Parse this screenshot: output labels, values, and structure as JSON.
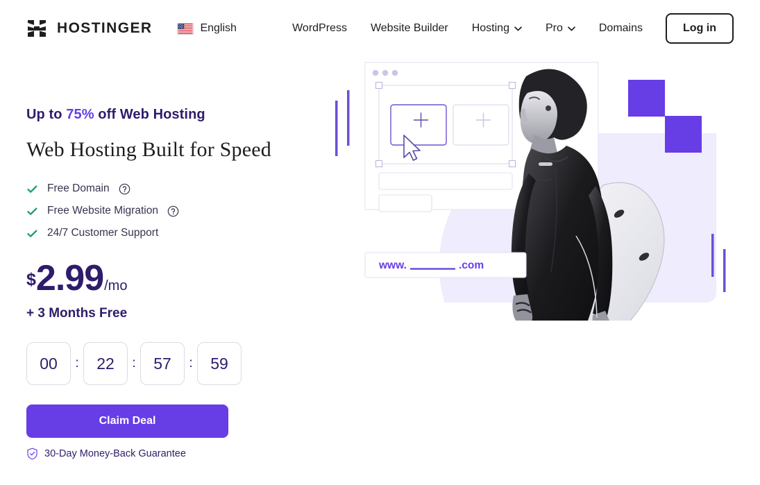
{
  "header": {
    "logo_icon": "hostinger-h-logo-icon",
    "brand_name": "HOSTINGER",
    "language": {
      "flag_icon": "us-flag-icon",
      "label": "English"
    },
    "nav_items": [
      {
        "label": "WordPress",
        "has_dropdown": false
      },
      {
        "label": "Website Builder",
        "has_dropdown": false
      },
      {
        "label": "Hosting",
        "has_dropdown": true
      },
      {
        "label": "Pro",
        "has_dropdown": true
      },
      {
        "label": "Domains",
        "has_dropdown": false
      }
    ],
    "login_label": "Log in"
  },
  "hero": {
    "eyebrow_prefix": "Up to ",
    "eyebrow_percent": "75%",
    "eyebrow_suffix": " off Web Hosting",
    "headline": "Web Hosting Built for Speed",
    "features": [
      {
        "label": "Free Domain",
        "has_help": true
      },
      {
        "label": "Free Website Migration",
        "has_help": true
      },
      {
        "label": "24/7 Customer Support",
        "has_help": false
      }
    ],
    "price": {
      "currency": "$",
      "amount": "2.99",
      "period": "/mo"
    },
    "bonus": "+ 3 Months Free",
    "timer": {
      "days": "00",
      "hours": "22",
      "minutes": "57",
      "seconds": "59",
      "separator": ":"
    },
    "cta_label": "Claim Deal",
    "guarantee": "30-Day Money-Back Guarantee"
  },
  "illustration": {
    "domain_prefix": "www.",
    "domain_suffix": ".com",
    "placeholder_plus": "+",
    "photo_alt": "surfer-in-wetsuit-carrying-board"
  },
  "colors": {
    "brand_purple": "#673de6",
    "deep_purple": "#2f1c6a",
    "check_green": "#21a07a",
    "ink": "#1d1e20",
    "slate_text": "#36344d",
    "panel_lavender": "#eeecfd",
    "border_light": "#dadbe5"
  }
}
